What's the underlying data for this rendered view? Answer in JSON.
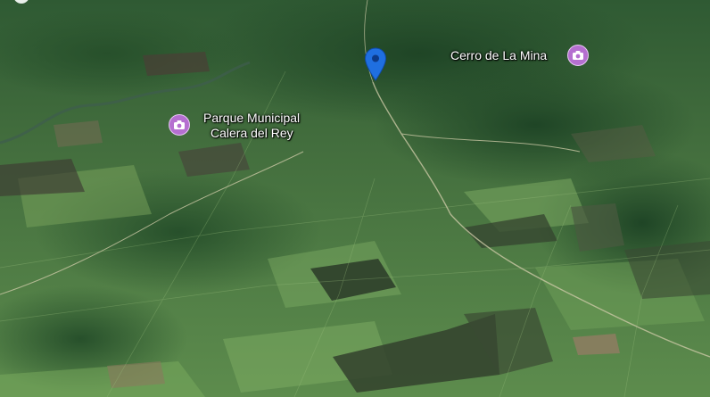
{
  "map": {
    "view": "satellite-3d",
    "colors": {
      "poi_pin": "#b56fd0",
      "location_pin": "#1f6fe0",
      "label_text": "#ffffff"
    }
  },
  "markers": {
    "location": {
      "icon": "location-pin-icon"
    },
    "poi_cerro": {
      "icon": "camera-icon",
      "label": "Cerro de La Mina"
    },
    "poi_parque": {
      "icon": "camera-icon",
      "label_line1": "Parque Municipal",
      "label_line2": "Calera del Rey"
    }
  }
}
